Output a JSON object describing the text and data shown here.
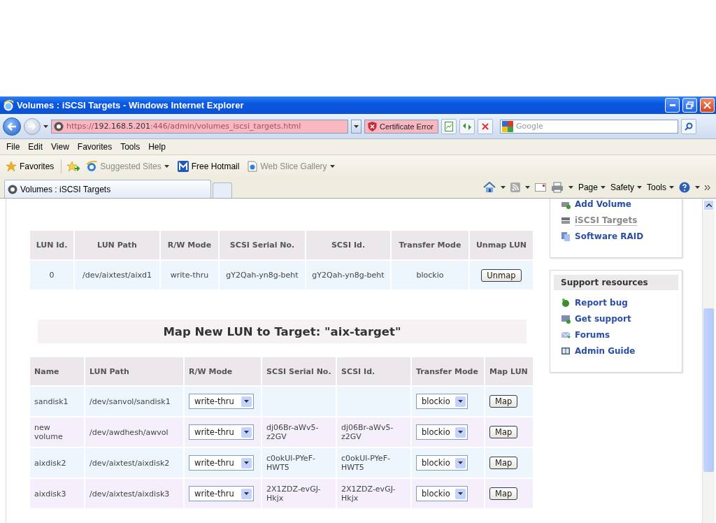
{
  "window": {
    "title": "Volumes : iSCSI Targets - Windows Internet Explorer"
  },
  "address_bar": {
    "scheme": "https://",
    "host": "192.168.5.201",
    "path": ":446/admin/volumes_iscsi_targets.html",
    "certificate": "Certificate Error"
  },
  "search": {
    "placeholder": "Google"
  },
  "menu": [
    "File",
    "Edit",
    "View",
    "Favorites",
    "Tools",
    "Help"
  ],
  "favorites_bar": {
    "label": "Favorites",
    "items": [
      {
        "label": "Suggested Sites",
        "kind": "ie",
        "dimmed": true,
        "dropdown": true
      },
      {
        "label": "Free Hotmail",
        "kind": "hotmail",
        "dimmed": false,
        "dropdown": false
      },
      {
        "label": "Web Slice Gallery",
        "kind": "slice",
        "dimmed": true,
        "dropdown": true
      }
    ]
  },
  "tabs": [
    {
      "label": "Volumes : iSCSI Targets",
      "selected": true
    }
  ],
  "command_bar": [
    "Page",
    "Safety",
    "Tools"
  ],
  "mapped_luns": {
    "columns": [
      "LUN Id.",
      "LUN Path",
      "R/W Mode",
      "SCSI Serial No.",
      "SCSI Id.",
      "Transfer Mode",
      "Unmap LUN"
    ],
    "rows": [
      {
        "lun_id": "0",
        "lun_path": "/dev/aixtest/aixd1",
        "rw_mode": "write-thru",
        "serial": "gY2Qah-yn8g-beht",
        "scsi_id": "gY2Qah-yn8g-beht",
        "transfer_mode": "blockio",
        "action": "Unmap"
      }
    ]
  },
  "map_new": {
    "title": "Map New LUN to Target: \"aix-target\"",
    "columns": [
      "Name",
      "LUN Path",
      "R/W Mode",
      "SCSI Serial No.",
      "SCSI Id.",
      "Transfer Mode",
      "Map LUN"
    ],
    "rows": [
      {
        "name": "sandisk1",
        "lun_path": "/dev/sanvol/sandisk1",
        "rw_mode": "write-thru",
        "transfer_mode": "blockio",
        "action": "Map"
      },
      {
        "name": "new volume",
        "lun_path": "/dev/awdhesh/awvol",
        "rw_mode": "write-thru",
        "serial": "dj06Br-aWv5-z2GV",
        "scsi_id": "dj06Br-aWv5-z2GV",
        "transfer_mode": "blockio",
        "action": "Map"
      },
      {
        "name": "aixdisk2",
        "lun_path": "/dev/aixtest/aixdisk2",
        "rw_mode": "write-thru",
        "serial": "c0okUl-PYeF-HWT5",
        "scsi_id": "c0okUl-PYeF-HWT5",
        "transfer_mode": "blockio",
        "action": "Map"
      },
      {
        "name": "aixdisk3",
        "lun_path": "/dev/aixtest/aixdisk3",
        "rw_mode": "write-thru",
        "serial": "2X1ZDZ-evGJ-Hkjx",
        "scsi_id": "2X1ZDZ-evGJ-Hkjx",
        "transfer_mode": "blockio",
        "action": "Map"
      }
    ]
  },
  "sidebar": {
    "volume_links": [
      {
        "label": "Add Volume",
        "kind": "add",
        "selected": false
      },
      {
        "label": "iSCSI Targets",
        "kind": "targets",
        "selected": true
      },
      {
        "label": "Software RAID",
        "kind": "raid",
        "selected": false
      }
    ],
    "support": {
      "title": "Support resources",
      "links": [
        {
          "label": "Report bug",
          "kind": "bug"
        },
        {
          "label": "Get support",
          "kind": "support"
        },
        {
          "label": "Forums",
          "kind": "forums"
        },
        {
          "label": "Admin Guide",
          "kind": "guide"
        }
      ]
    }
  }
}
